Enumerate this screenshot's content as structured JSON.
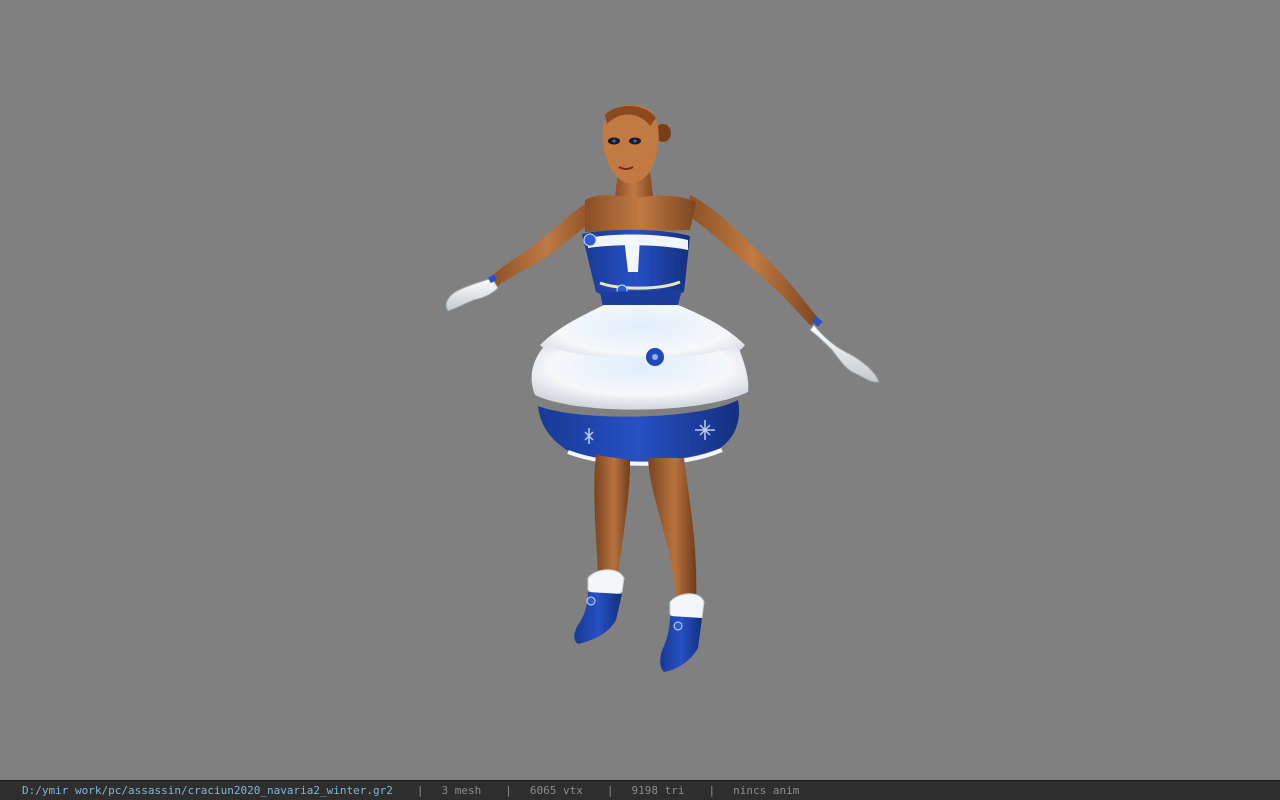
{
  "window": {
    "background": "#808080"
  },
  "viewport": {
    "model_name": "craciun2020_navaria2_winter"
  },
  "statusbar": {
    "path": "D:/ymir work/pc/assassin/craciun2020_navaria2_winter.gr2",
    "separator": "|",
    "mesh_count": "3 mesh",
    "vertex_count": "6065 vtx",
    "triangle_count": "9198 tri",
    "anim_status": "nincs anim"
  },
  "colors": {
    "dress_blue": "#1f43a6",
    "dress_white": "#eef3f8",
    "skin": "#b5733e",
    "status_path": "#7fb8d6",
    "status_text": "#8c8c8c"
  }
}
